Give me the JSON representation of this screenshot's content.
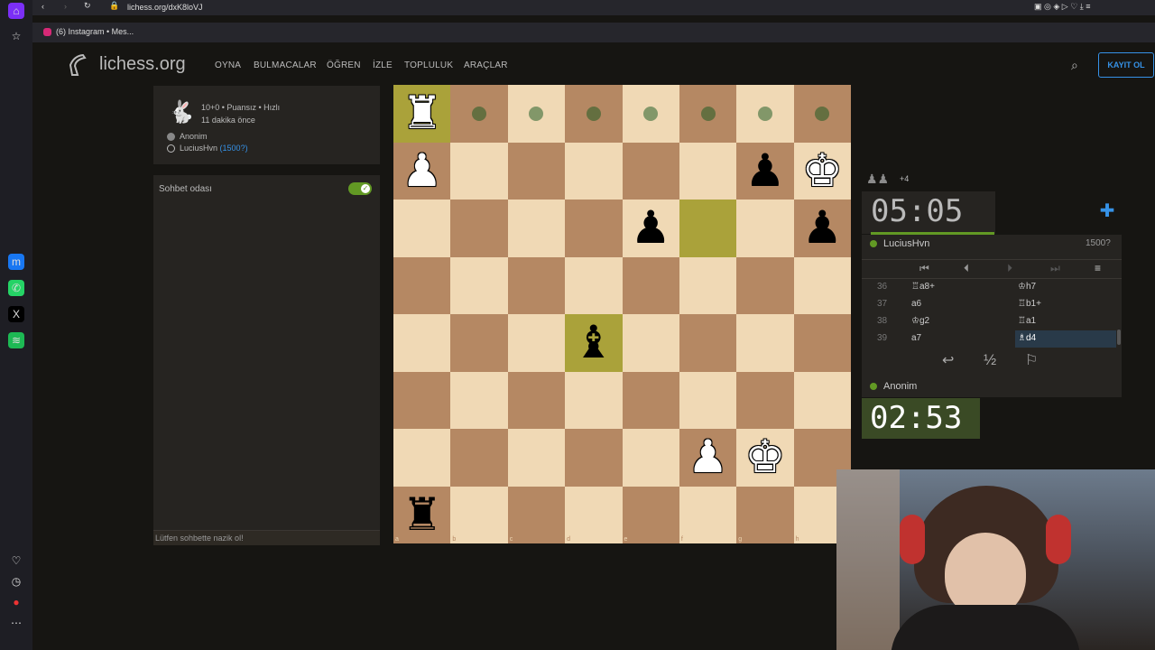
{
  "browser": {
    "url": "lichess.org/dxK8loVJ",
    "bookmark": "(6) Instagram • Mes..."
  },
  "header": {
    "logo": "lichess.org",
    "nav": [
      "OYNA",
      "BULMACALAR",
      "ÖĞREN",
      "İZLE",
      "TOPLULUK",
      "ARAÇLAR"
    ],
    "login": "KAYIT OL"
  },
  "game_info": {
    "title": "10+0 • Puansız • Hızlı",
    "time_ago": "11 dakika önce",
    "player1": "Anonim",
    "player2": "LuciusHvn",
    "player2_rating": "(1500?)"
  },
  "chat": {
    "title": "Sohbet odası",
    "placeholder": "Lütfen sohbette nazik ol!"
  },
  "board": {
    "files": [
      "a",
      "b",
      "c",
      "d",
      "e",
      "f",
      "g",
      "h"
    ],
    "ranks": [
      "8",
      "7",
      "6",
      "5",
      "4",
      "3",
      "2"
    ],
    "pieces": [
      {
        "sq": "a8",
        "glyph": "♜",
        "color": "white"
      },
      {
        "sq": "a7",
        "glyph": "♟",
        "color": "white"
      },
      {
        "sq": "g7",
        "glyph": "♟",
        "color": "black"
      },
      {
        "sq": "h7",
        "glyph": "♚",
        "color": "white"
      },
      {
        "sq": "e6",
        "glyph": "♟",
        "color": "black"
      },
      {
        "sq": "h6",
        "glyph": "♟",
        "color": "black"
      },
      {
        "sq": "d4",
        "glyph": "♝",
        "color": "black"
      },
      {
        "sq": "f2",
        "glyph": "♟",
        "color": "white"
      },
      {
        "sq": "g2",
        "glyph": "♚",
        "color": "white"
      },
      {
        "sq": "a1",
        "glyph": "♜",
        "color": "black"
      }
    ],
    "dots": [
      "b8",
      "c8",
      "d8",
      "e8",
      "f8",
      "g8",
      "h8"
    ],
    "highlights": {
      "a8": "#aaa23a",
      "f6": "#aaa23a",
      "d4": "#aaa23a"
    }
  },
  "right": {
    "captured": "+4",
    "top_clock": "05:05",
    "top_player": "LuciusHvn",
    "top_rating": "1500?",
    "bottom_player": "Anonim",
    "bottom_clock": "02:53",
    "draw_label": "½",
    "moves": [
      {
        "num": "36",
        "white": "♖a8+",
        "black": "♔h7"
      },
      {
        "num": "37",
        "white": "a6",
        "black": "♖b1+"
      },
      {
        "num": "38",
        "white": "♔g2",
        "black": "♖a1"
      },
      {
        "num": "39",
        "white": "a7",
        "black": "♗d4"
      }
    ]
  },
  "colors": {
    "accent": "#3692e7",
    "online": "#629924",
    "highlight": "#aaa23a"
  }
}
